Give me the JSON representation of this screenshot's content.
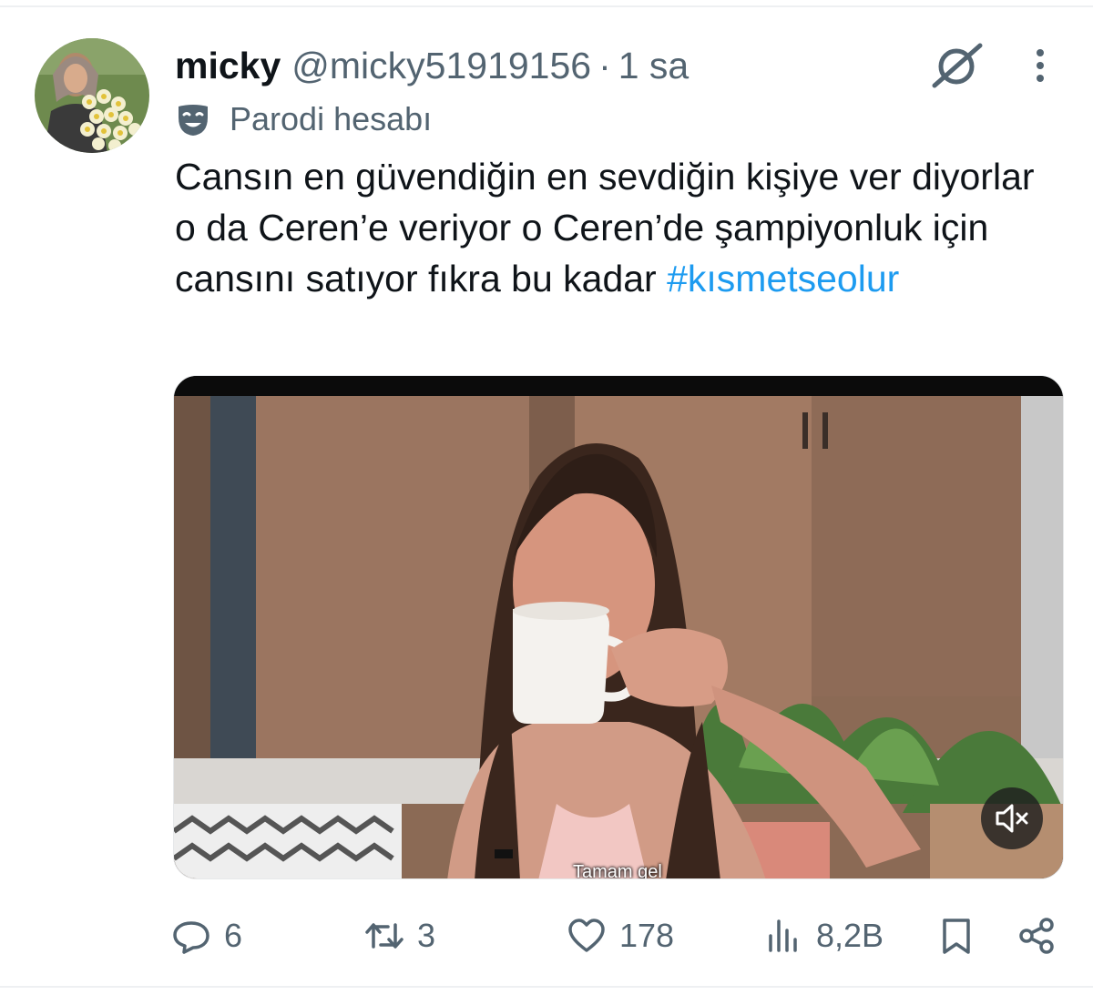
{
  "tweet": {
    "author_name": "micky",
    "author_handle": "@micky51919156",
    "separator": "·",
    "time": "1 sa",
    "badge_label": "Parodi hesabı",
    "text": "Cansın en güvendiğin en sevdiğin kişiye ver diyorlar o da Ceren’e veriyor o Ceren’de şampiyonluk için cansını satıyor fıkra bu kadar ",
    "hashtag": "#kısmetseolur"
  },
  "media": {
    "subtitle": "Tamam gel",
    "mute_icon": "volume-muted-icon"
  },
  "actions": {
    "replies": "6",
    "retweets": "3",
    "likes": "178",
    "views": "8,2B"
  },
  "icons": {
    "grok": "grok-icon",
    "more": "more-vertical-icon",
    "badge": "parody-mask-icon",
    "reply": "reply-icon",
    "retweet": "retweet-icon",
    "like": "heart-icon",
    "views": "views-chart-icon",
    "bookmark": "bookmark-icon",
    "share": "share-icon"
  },
  "colors": {
    "text": "#0f1419",
    "secondary": "#536471",
    "link": "#1d9bf0"
  }
}
